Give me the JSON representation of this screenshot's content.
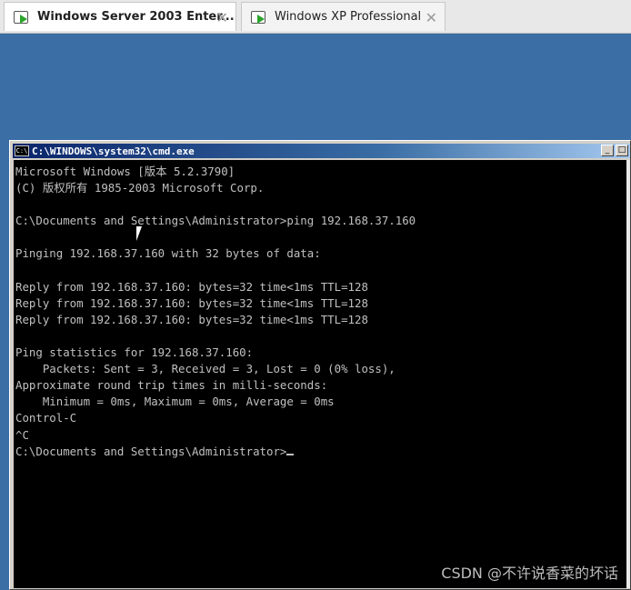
{
  "tabs": [
    {
      "label": "Windows Server 2003 Enter...",
      "active": true,
      "icon": "vm-play-icon"
    },
    {
      "label": "Windows XP Professional",
      "active": false,
      "icon": "vm-play-icon"
    }
  ],
  "tab_close_glyph": "✕",
  "cmd_window": {
    "title": "C:\\WINDOWS\\system32\\cmd.exe",
    "icon_text": "C:\\",
    "buttons": {
      "minimize": "_",
      "maximize": "□"
    },
    "lines": [
      "Microsoft Windows [版本 5.2.3790]",
      "(C) 版权所有 1985-2003 Microsoft Corp.",
      "",
      "C:\\Documents and Settings\\Administrator>ping 192.168.37.160",
      "",
      "Pinging 192.168.37.160 with 32 bytes of data:",
      "",
      "Reply from 192.168.37.160: bytes=32 time<1ms TTL=128",
      "Reply from 192.168.37.160: bytes=32 time<1ms TTL=128",
      "Reply from 192.168.37.160: bytes=32 time<1ms TTL=128",
      "",
      "Ping statistics for 192.168.37.160:",
      "    Packets: Sent = 3, Received = 3, Lost = 0 (0% loss),",
      "Approximate round trip times in milli-seconds:",
      "    Minimum = 0ms, Maximum = 0ms, Average = 0ms",
      "Control-C",
      "^C",
      "C:\\Documents and Settings\\Administrator>"
    ]
  },
  "watermark": "CSDN @不许说香菜的坏话",
  "colors": {
    "desktop": "#3a6ea5",
    "titlebar_start": "#0a246a",
    "console_bg": "#000000",
    "console_fg": "#c0c0c0"
  }
}
